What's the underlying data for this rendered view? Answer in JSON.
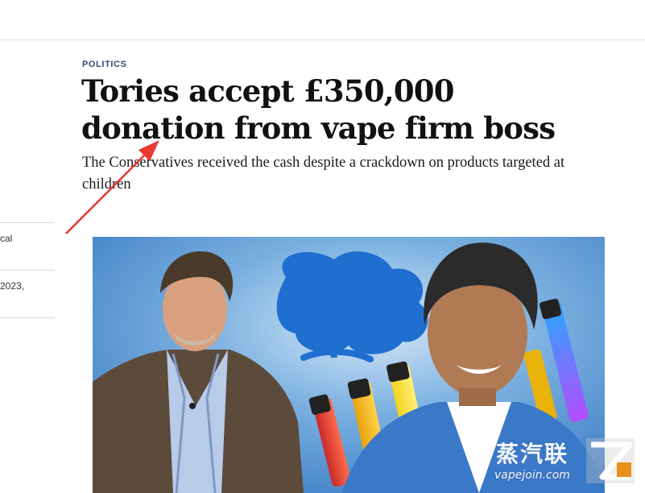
{
  "article": {
    "section": "POLITICS",
    "headline": "Tories accept £350,000 donation from vape firm boss",
    "standfirst": "The Conservatives received the cash despite a crackdown on products targeted at children"
  },
  "sidebar": {
    "fragment_1": "cal",
    "fragment_2": "2023,"
  },
  "watermark": {
    "chinese": "蒸汽联",
    "url": "vapejoin.com"
  },
  "colors": {
    "section": "#2b4d7a",
    "annotation_arrow": "#e8382f",
    "hero_background": "#4a8fd0"
  }
}
